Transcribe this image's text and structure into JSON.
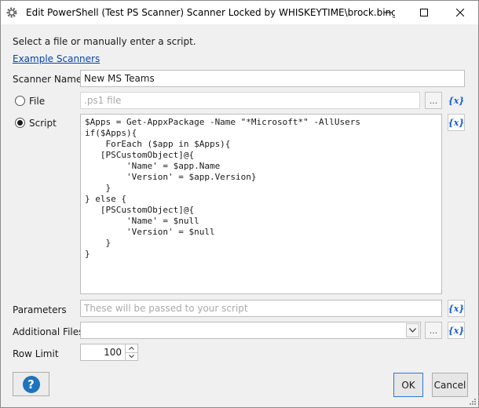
{
  "window": {
    "title": "Edit PowerShell (Test PS Scanner) Scanner Locked by WHISKEYTIME\\brock.bingham on..."
  },
  "intro": {
    "text": "Select a file or manually enter a script.",
    "link": "Example Scanners"
  },
  "scanner_name": {
    "label": "Scanner Name",
    "value": "New MS Teams"
  },
  "file": {
    "label": "File",
    "placeholder": ".ps1 file",
    "browse": "...",
    "variable": "{x}",
    "selected": false
  },
  "script": {
    "label": "Script",
    "variable": "{x}",
    "selected": true,
    "code": "$Apps = Get-AppxPackage -Name \"*Microsoft*\" -AllUsers\nif($Apps){\n    ForEach ($app in $Apps){\n   [PSCustomObject]@{\n        'Name' = $app.Name\n        'Version' = $app.Version}\n    }\n} else {\n   [PSCustomObject]@{\n        'Name' = $null\n        'Version' = $null\n    }\n}"
  },
  "parameters": {
    "label": "Parameters",
    "placeholder": "These will be passed to your script",
    "variable": "{x}"
  },
  "additional_files": {
    "label": "Additional Files",
    "value": "",
    "browse": "...",
    "variable": "{x}"
  },
  "row_limit": {
    "label": "Row Limit",
    "value": "100"
  },
  "buttons": {
    "help": "?",
    "ok": "OK",
    "cancel": "Cancel"
  },
  "colors": {
    "accent": "#1a5fd1",
    "help_blue": "#1e73be",
    "link": "#0645ad"
  }
}
